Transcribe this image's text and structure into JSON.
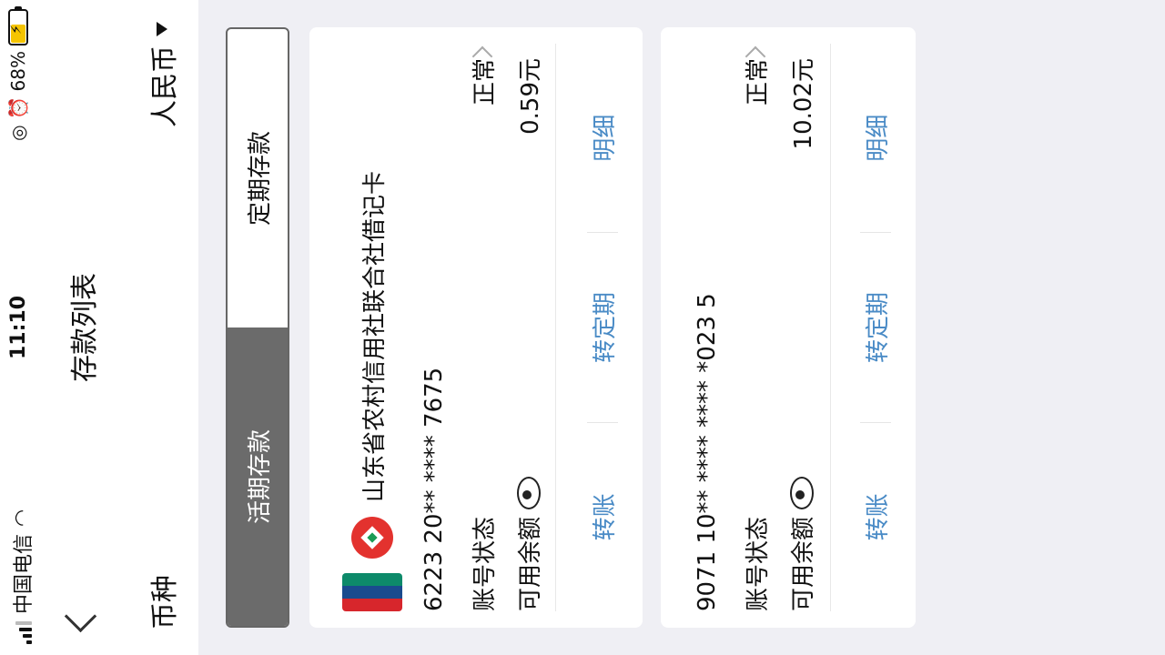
{
  "status_bar": {
    "carrier": "中国电信",
    "time": "11:10",
    "battery_percent": "68%",
    "battery_level": 0.68,
    "wifi_icon": "wifi-icon",
    "lock_icon": "orientation-lock-icon",
    "alarm_icon": "alarm-icon"
  },
  "nav": {
    "title": "存款列表",
    "back_icon": "chevron-left-icon"
  },
  "currency": {
    "label": "币种",
    "selected": "人民币"
  },
  "tabs": [
    {
      "label": "活期存款",
      "active": true
    },
    {
      "label": "定期存款",
      "active": false
    }
  ],
  "accounts": [
    {
      "bank_name": "山东省农村信用社联合社借记卡",
      "account_number": "6223 20** **** 7675",
      "status_label": "账号状态",
      "status_value": "正常",
      "balance_label": "可用余额",
      "balance_value": "0.59元",
      "actions": [
        "转账",
        "转定期",
        "明细"
      ]
    },
    {
      "bank_name": "",
      "account_number": "9071 10** **** **** *023 5",
      "status_label": "账号状态",
      "status_value": "正常",
      "balance_label": "可用余额",
      "balance_value": "10.02元",
      "actions": [
        "转账",
        "转定期",
        "明细"
      ]
    }
  ],
  "colors": {
    "accent": "#4a8bc6",
    "active_tab": "#6b6b6b",
    "background": "#efeff4"
  }
}
